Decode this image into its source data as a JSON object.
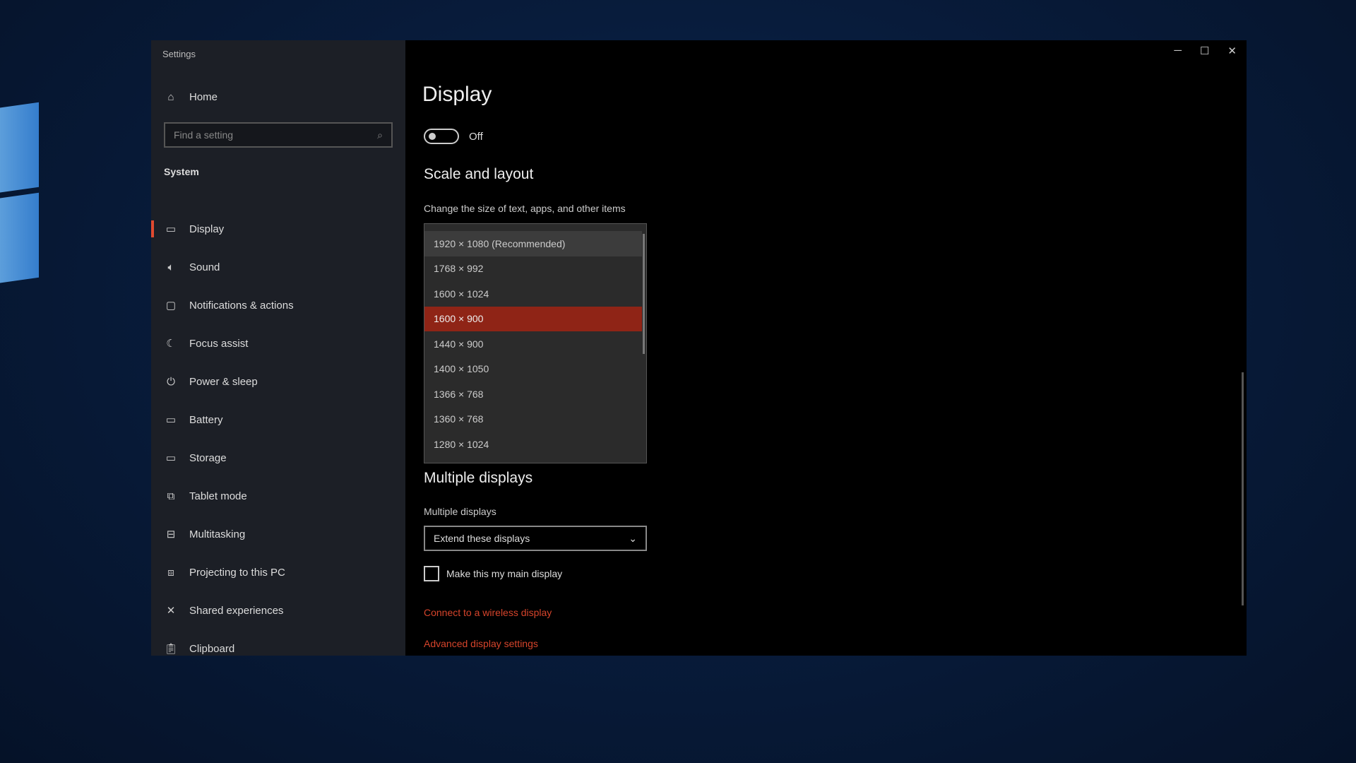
{
  "window": {
    "title": "Settings",
    "controls": {
      "minimize": "─",
      "maximize": "☐",
      "close": "✕"
    }
  },
  "sidebar": {
    "home": "Home",
    "search_placeholder": "Find a setting",
    "section": "System",
    "items": [
      {
        "label": "Display",
        "icon": "monitor-icon",
        "glyph": "▭",
        "active": true
      },
      {
        "label": "Sound",
        "icon": "speaker-icon",
        "glyph": "🔈︎"
      },
      {
        "label": "Notifications & actions",
        "icon": "notification-icon",
        "glyph": "▢"
      },
      {
        "label": "Focus assist",
        "icon": "moon-icon",
        "glyph": "☾"
      },
      {
        "label": "Power & sleep",
        "icon": "power-icon",
        "glyph": "⏻"
      },
      {
        "label": "Battery",
        "icon": "battery-icon",
        "glyph": "▭"
      },
      {
        "label": "Storage",
        "icon": "storage-icon",
        "glyph": "▭"
      },
      {
        "label": "Tablet mode",
        "icon": "tablet-icon",
        "glyph": "⧉"
      },
      {
        "label": "Multitasking",
        "icon": "multitasking-icon",
        "glyph": "⊟"
      },
      {
        "label": "Projecting to this PC",
        "icon": "projector-icon",
        "glyph": "⧈"
      },
      {
        "label": "Shared experiences",
        "icon": "shared-icon",
        "glyph": "✕"
      },
      {
        "label": "Clipboard",
        "icon": "clipboard-icon",
        "glyph": "📋︎"
      }
    ]
  },
  "main": {
    "title": "Display",
    "toggle_state": "Off",
    "scale_heading": "Scale and layout",
    "scale_label": "Change the size of text, apps, and other items",
    "resolution_options": [
      "1920 × 1080 (Recommended)",
      "1768 × 992",
      "1600 × 1024",
      "1600 × 900",
      "1440 × 900",
      "1400 × 1050",
      "1366 × 768",
      "1360 × 768",
      "1280 × 1024"
    ],
    "selected_resolution": "1600 × 900",
    "multi_heading": "Multiple displays",
    "multi_label": "Multiple displays",
    "multi_value": "Extend these displays",
    "main_display_checkbox": "Make this my main display",
    "main_display_checked": false,
    "link_wireless": "Connect to a wireless display",
    "link_advanced": "Advanced display settings"
  },
  "colors": {
    "accent": "#e04a2f",
    "selected": "#8f2416",
    "link": "#d6442b"
  }
}
